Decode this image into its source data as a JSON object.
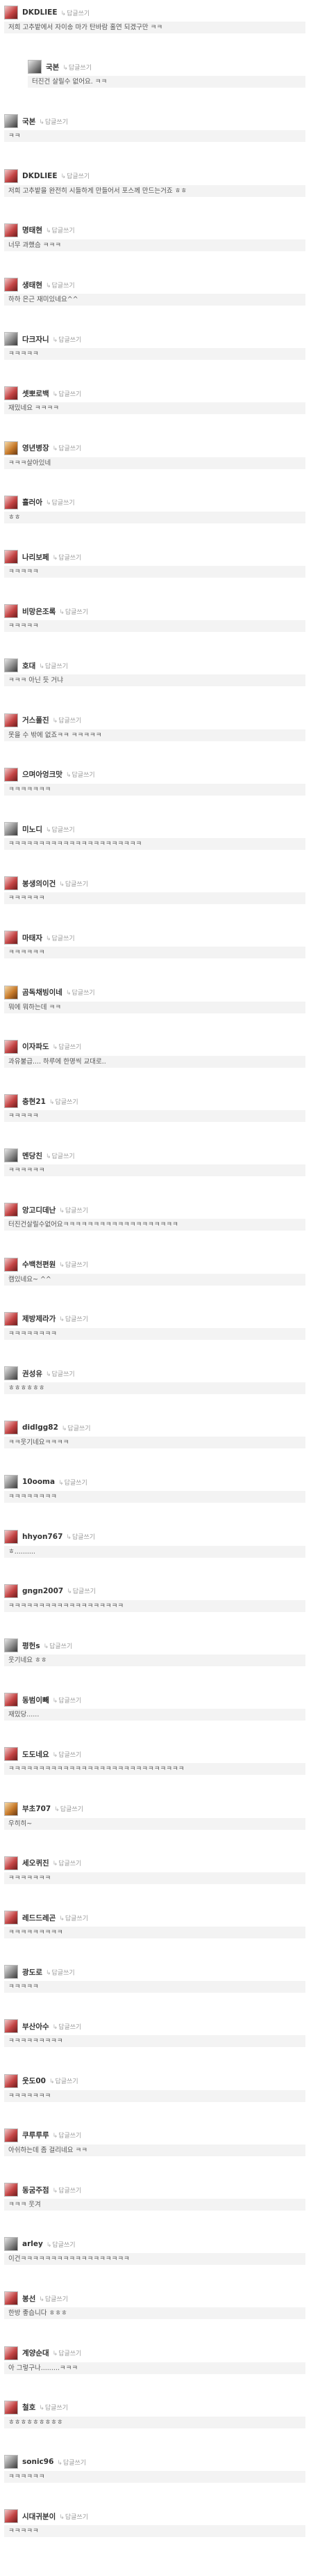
{
  "reply_label": "답글쓰기",
  "reply_arrow": "↳",
  "comments": [
    {
      "nick": "DKDLIEE",
      "text": "저희 고추밭에서 자이송 마가 탄바람 홀연 되겠구만 ㅋㅋ",
      "reply": false,
      "av": ""
    },
    {
      "nick": "국본",
      "text": "터진건 살릴수 없어요. ㅋㅋ",
      "reply": true,
      "av": "av-b"
    },
    {
      "nick": "국본",
      "text": "ㅋㅋ",
      "reply": false,
      "av": "av-b"
    },
    {
      "nick": "DKDLIEE",
      "text": "저희 고추밭을 완전히 시들하게 만들어서 포스께 만드는거죠 ㅎㅎ",
      "reply": false,
      "av": ""
    },
    {
      "nick": "명태현",
      "text": "너무 과했슴 ㅋㅋㅋ",
      "reply": false,
      "av": ""
    },
    {
      "nick": "생태현",
      "text": "하하 은근 재미있네요^^",
      "reply": false,
      "av": ""
    },
    {
      "nick": "다크자니",
      "text": "ㅋㅋㅋㅋㅋ",
      "reply": false,
      "av": "av-b"
    },
    {
      "nick": "셋뽀로백",
      "text": "재밌네요 ㅋㅋㅋㅋ",
      "reply": false,
      "av": ""
    },
    {
      "nick": "영년병장",
      "text": "ㅋㅋㅋ살아있네",
      "reply": false,
      "av": "av-c"
    },
    {
      "nick": "흘러아",
      "text": "ㅎㅎ",
      "reply": false,
      "av": ""
    },
    {
      "nick": "나리보페",
      "text": "ㅋㅋㅋㅋㅋ",
      "reply": false,
      "av": ""
    },
    {
      "nick": "비망은조록",
      "text": "ㅋㅋㅋㅋㅋ",
      "reply": false,
      "av": ""
    },
    {
      "nick": "호대",
      "text": "ㅋㅋㅋ 아닌 듯 거냐",
      "reply": false,
      "av": "av-b"
    },
    {
      "nick": "거스폴진",
      "text": "못을 수 밖에 없죠ㅋㅋ ㅋㅋㅋㅋㅋ",
      "reply": false,
      "av": ""
    },
    {
      "nick": "으며아엉크맛",
      "text": "ㅋㅋㅋㅋㅋㅋㅋ",
      "reply": false,
      "av": ""
    },
    {
      "nick": "미노디",
      "text": "ㅋㅋㅋㅋㅋㅋㅋㅋㅋㅋㅋㅋㅋㅋㅋㅋㅋㅋㅋㅋㅋㅋ",
      "reply": false,
      "av": "av-b"
    },
    {
      "nick": "봉생의이건",
      "text": "ㅋㅋㅋㅋㅋㅋ",
      "reply": false,
      "av": ""
    },
    {
      "nick": "마태자",
      "text": "ㅋㅋㅋㅋㅋㅋ",
      "reply": false,
      "av": ""
    },
    {
      "nick": "곰독채빙이네",
      "text": "뭐에 뭐하는데 ㅋㅋ",
      "reply": false,
      "av": "av-c"
    },
    {
      "nick": "이자파도",
      "text": "과유불급.... 하루에 한명씩 교대로..",
      "reply": false,
      "av": ""
    },
    {
      "nick": "충현21",
      "text": "ㅋㅋㅋㅋㅋ",
      "reply": false,
      "av": ""
    },
    {
      "nick": "멘당친",
      "text": "ㅋㅋㅋㅋㅋㅋ",
      "reply": false,
      "av": "av-b"
    },
    {
      "nick": "앙고디데난",
      "text": "터진건살릴수없어요ㅋㅋㅋㅋㅋㅋㅋㅋㅋㅋㅋㅋㅋㅋㅋㅋㅋㅋㅋ",
      "reply": false,
      "av": ""
    },
    {
      "nick": "수백천편원",
      "text": "캠있네요~ ^^",
      "reply": false,
      "av": ""
    },
    {
      "nick": "제방제라가",
      "text": "ㅋㅋㅋㅋㅋㅋㅋㅋ",
      "reply": false,
      "av": ""
    },
    {
      "nick": "권성유",
      "text": "ㅎㅎㅎㅎㅎㅎ",
      "reply": false,
      "av": "av-b"
    },
    {
      "nick": "didlgg82",
      "text": "ㅋㅋ웃기네요ㅋㅋㅋㅋ",
      "reply": false,
      "av": ""
    },
    {
      "nick": "10ooma",
      "text": "ㅋㅋㅋㅋㅋㅋㅋㅋ",
      "reply": false,
      "av": "av-b"
    },
    {
      "nick": "hhyon767",
      "text": "ㅎ..........",
      "reply": false,
      "av": ""
    },
    {
      "nick": "gngn2007",
      "text": "ㅋㅋㅋㅋㅋㅋㅋㅋㅋㅋㅋㅋㅋㅋㅋㅋㅋㅋㅋ",
      "reply": false,
      "av": ""
    },
    {
      "nick": "평헌s",
      "text": "웃기네요 ㅎㅎ",
      "reply": false,
      "av": "av-b"
    },
    {
      "nick": "동범이빼",
      "text": "재밌당......",
      "reply": false,
      "av": ""
    },
    {
      "nick": "도도네요",
      "text": "ㅋㅋㅋㅋㅋㅋㅋㅋㅋㅋㅋㅋㅋㅋㅋㅋㅋㅋㅋㅋㅋㅋㅋㅋㅋㅋㅋㅋㅋ",
      "reply": false,
      "av": ""
    },
    {
      "nick": "부초707",
      "text": "우히히~",
      "reply": false,
      "av": "av-c"
    },
    {
      "nick": "세오퀴진",
      "text": "ㅋㅋㅋㅋㅋㅋㅋ",
      "reply": false,
      "av": ""
    },
    {
      "nick": "레드드레곤",
      "text": "ㅋㅋㅋㅋㅋㅋㅋㅋㅋ",
      "reply": false,
      "av": ""
    },
    {
      "nick": "광도로",
      "text": "ㅋㅋㅋㅋㅋ",
      "reply": false,
      "av": "av-b"
    },
    {
      "nick": "부산아수",
      "text": "ㅋㅋㅋㅋㅋㅋㅋㅋㅋ",
      "reply": false,
      "av": ""
    },
    {
      "nick": "웃도00",
      "text": "ㅋㅋㅋㅋㅋㅋㅋ",
      "reply": false,
      "av": ""
    },
    {
      "nick": "쿠루루루",
      "text": "아쉬하는데 좀 걸리네요 ㅋㅋ",
      "reply": false,
      "av": ""
    },
    {
      "nick": "동굼주점",
      "text": "ㅋㅋㅋ 웃겨",
      "reply": false,
      "av": ""
    },
    {
      "nick": "arley",
      "text": "이건ㅋㅋㅋㅋㅋㅋㅋㅋㅋㅋㅋㅋㅋㅋㅋㅋㅋㅋ",
      "reply": false,
      "av": "av-b"
    },
    {
      "nick": "봉선",
      "text": "한방 좋습니다 ㅎㅎㅎ",
      "reply": false,
      "av": ""
    },
    {
      "nick": "계양순대",
      "text": "아 그렇구나.........ㅋㅋㅋ",
      "reply": false,
      "av": ""
    },
    {
      "nick": "철호",
      "text": "ㅎㅎㅎㅎㅎㅎㅎㅎㅎ",
      "reply": false,
      "av": ""
    },
    {
      "nick": "sonic96",
      "text": "ㅋㅋㅋㅋㅋㅋ",
      "reply": false,
      "av": "av-b"
    },
    {
      "nick": "시대귀분이",
      "text": "ㅋㅋㅋㅋㅋ",
      "reply": false,
      "av": ""
    }
  ]
}
